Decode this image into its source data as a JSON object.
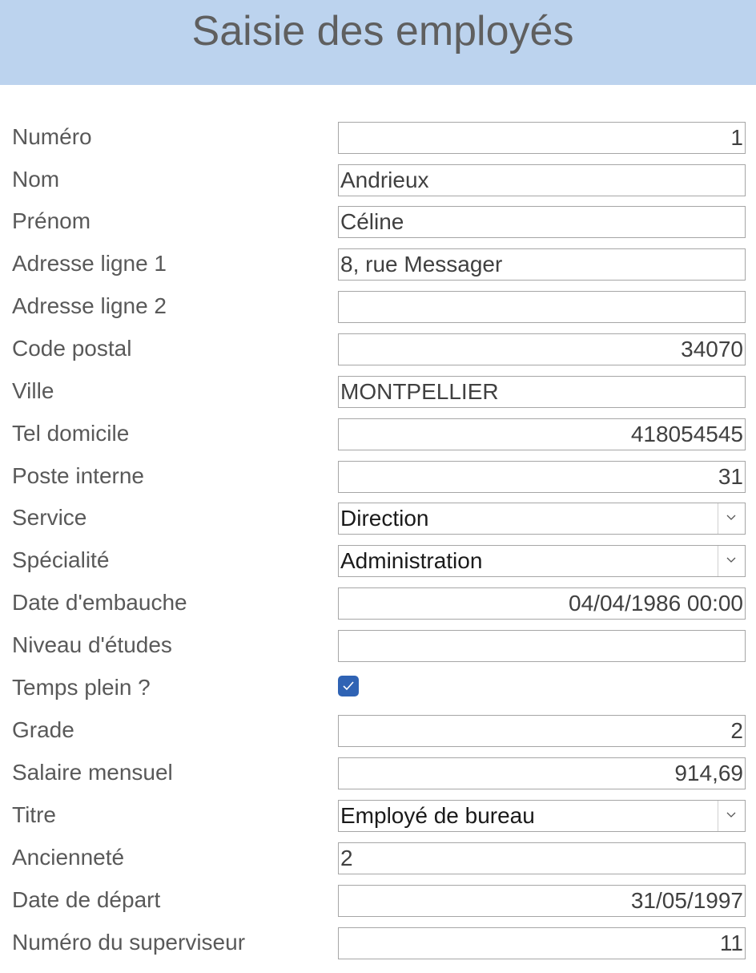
{
  "header": {
    "title": "Saisie des employés"
  },
  "form": {
    "numero": {
      "label": "Numéro",
      "value": "1"
    },
    "nom": {
      "label": "Nom",
      "value": "Andrieux"
    },
    "prenom": {
      "label": "Prénom",
      "value": "Céline"
    },
    "adresse1": {
      "label": "Adresse ligne 1",
      "value": "8, rue Messager"
    },
    "adresse2": {
      "label": "Adresse ligne 2",
      "value": ""
    },
    "code_postal": {
      "label": "Code postal",
      "value": "34070"
    },
    "ville": {
      "label": "Ville",
      "value": "MONTPELLIER"
    },
    "tel_domicile": {
      "label": "Tel domicile",
      "value": "418054545"
    },
    "poste_interne": {
      "label": "Poste interne",
      "value": "31"
    },
    "service": {
      "label": "Service",
      "value": "Direction"
    },
    "specialite": {
      "label": "Spécialité",
      "value": "Administration"
    },
    "date_embauche": {
      "label": "Date d'embauche",
      "value": "04/04/1986 00:00"
    },
    "niveau_etudes": {
      "label": "Niveau d'études",
      "value": ""
    },
    "temps_plein": {
      "label": "Temps plein ?",
      "checked": true
    },
    "grade": {
      "label": "Grade",
      "value": "2"
    },
    "salaire": {
      "label": "Salaire mensuel",
      "value": "914,69"
    },
    "titre": {
      "label": "Titre",
      "value": "Employé de bureau"
    },
    "anciennete": {
      "label": "Ancienneté",
      "value": "2"
    },
    "date_depart": {
      "label": "Date de départ",
      "value": "31/05/1997"
    },
    "superviseur": {
      "label": "Numéro du superviseur",
      "value": "11"
    }
  },
  "colors": {
    "header_bg": "#bcd3ee",
    "checkbox_accent": "#2f63b4"
  }
}
